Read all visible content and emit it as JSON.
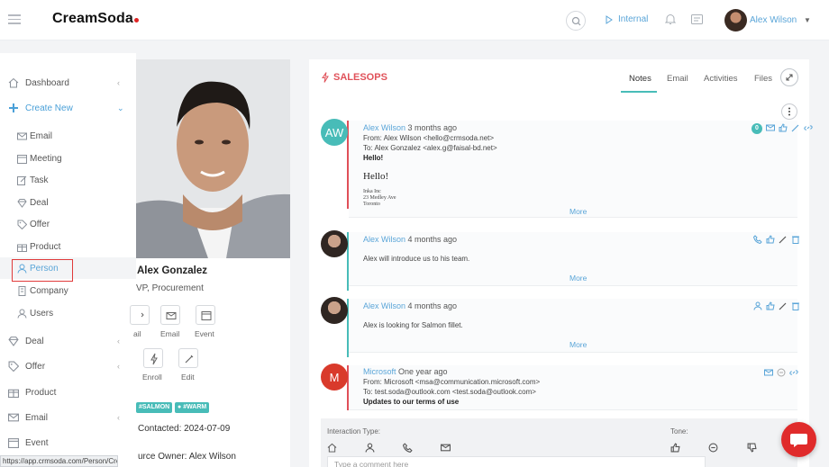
{
  "app": {
    "logo_text": "CreamSoda",
    "brand_color": "#e02424",
    "accent_color": "#48bcb8",
    "link_color": "#5aa5d8"
  },
  "header": {
    "mode_label": "Internal",
    "user_name": "Alex Wilson"
  },
  "sidebar": {
    "items": [
      {
        "label": "Dashboard",
        "icon": "home-icon"
      },
      {
        "label": "Create New",
        "icon": "plus-icon"
      },
      {
        "label": "Email",
        "icon": "mail-icon"
      },
      {
        "label": "Meeting",
        "icon": "calendar-icon"
      },
      {
        "label": "Task",
        "icon": "edit-icon"
      },
      {
        "label": "Deal",
        "icon": "diamond-icon"
      },
      {
        "label": "Offer",
        "icon": "tag-icon"
      },
      {
        "label": "Product",
        "icon": "gift-icon"
      },
      {
        "label": "Person",
        "icon": "user-icon"
      },
      {
        "label": "Company",
        "icon": "building-icon"
      },
      {
        "label": "Users",
        "icon": "user-icon"
      },
      {
        "label": "Deal",
        "icon": "diamond-icon"
      },
      {
        "label": "Offer",
        "icon": "tag-icon"
      },
      {
        "label": "Product",
        "icon": "gift-icon"
      },
      {
        "label": "Email",
        "icon": "mail-icon"
      },
      {
        "label": "Event",
        "icon": "calendar-icon"
      }
    ],
    "status_url": "https://app.crmsoda.com/Person/Create"
  },
  "profile": {
    "name": "Alex Gonzalez",
    "title": "VP, Procurement",
    "actions": [
      "ail",
      "Email",
      "Event",
      "Enroll",
      "Edit"
    ],
    "tags": [
      "#SALMON",
      "#WARM"
    ],
    "last_contacted": "Contacted: 2024-07-09",
    "source_owner": "urce Owner: Alex Wilson"
  },
  "main": {
    "title": "SALESOPS",
    "tabs": [
      "Notes",
      "Email",
      "Activities",
      "Files"
    ],
    "notes": [
      {
        "avatar_text": "AW",
        "avatar_color": "#48bcb8",
        "author": "Alex Wilson",
        "ago": "3 months ago",
        "from": "From: Alex Wilson <hello@crmsoda.net>",
        "to": "To: Alex Gonzalez <alex.g@faisal-bd.net>",
        "subject": "Hello!",
        "body_heading": "Hello!",
        "body_line1": "Inka Inc",
        "body_line2": "23 Medley Ave",
        "body_line3": "Toronto",
        "badge": "0",
        "more": "More"
      },
      {
        "author": "Alex Wilson",
        "ago": "4 months ago",
        "text": "Alex will introduce us to his team.",
        "more": "More"
      },
      {
        "author": "Alex Wilson",
        "ago": "4 months ago",
        "text": "Alex is looking for Salmon fillet.",
        "more": "More"
      },
      {
        "avatar_text": "M",
        "avatar_color": "#d93a2b",
        "author": "Microsoft",
        "ago": "One year ago",
        "from": "From: Microsoft <msa@communication.microsoft.com>",
        "to": "To: test.soda@outlook.com <test.soda@outlook.com>",
        "subject": "Updates to our terms of use"
      }
    ],
    "interaction": {
      "type_label": "Interaction Type:",
      "tone_label": "Tone:",
      "comment_placeholder": "Type a comment here"
    }
  }
}
